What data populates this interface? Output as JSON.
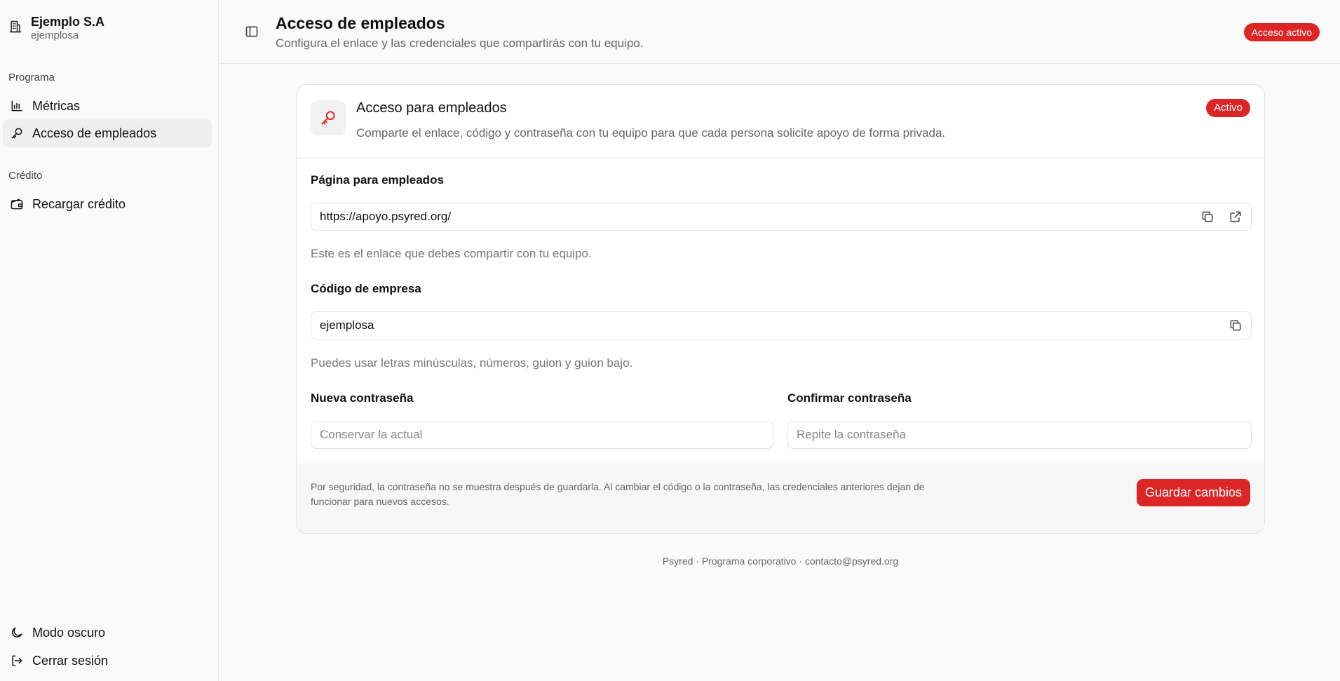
{
  "sidebar": {
    "org_name": "Ejemplo S.A",
    "org_slug": "ejemplosa",
    "section_program": "Programa",
    "item_metrics": "Métricas",
    "item_access": "Acceso de empleados",
    "section_credit": "Crédito",
    "item_recharge": "Recargar crédito",
    "item_dark_mode": "Modo oscuro",
    "item_logout": "Cerrar sesión"
  },
  "header": {
    "title": "Acceso de empleados",
    "subtitle": "Configura el enlace y las credenciales que compartirás con tu equipo.",
    "badge": "Acceso activo"
  },
  "card": {
    "title": "Acceso para empleados",
    "description": "Comparte el enlace, código y contraseña con tu equipo para que cada persona solicite apoyo de forma privada.",
    "badge": "Activo",
    "page_label": "Página para empleados",
    "page_url": "https://apoyo.psyred.org/",
    "page_hint": "Este es el enlace que debes compartir con tu equipo.",
    "code_label": "Código de empresa",
    "code_value": "ejemplosa",
    "code_hint": "Puedes usar letras minúsculas, números, guion y guion bajo.",
    "new_password_label": "Nueva contraseña",
    "new_password_placeholder": "Conservar la actual",
    "confirm_password_label": "Confirmar contraseña",
    "confirm_password_placeholder": "Repite la contraseña",
    "security_note": "Por seguridad, la contraseña no se muestra después de guardarla. Al cambiar el código o la contraseña, las credenciales anteriores dejan de funcionar para nuevos accesos.",
    "save_label": "Guardar cambios"
  },
  "footer": {
    "text": "Psyred · Programa corporativo · contacto@psyred.org"
  },
  "colors": {
    "accent": "#dc2626"
  }
}
